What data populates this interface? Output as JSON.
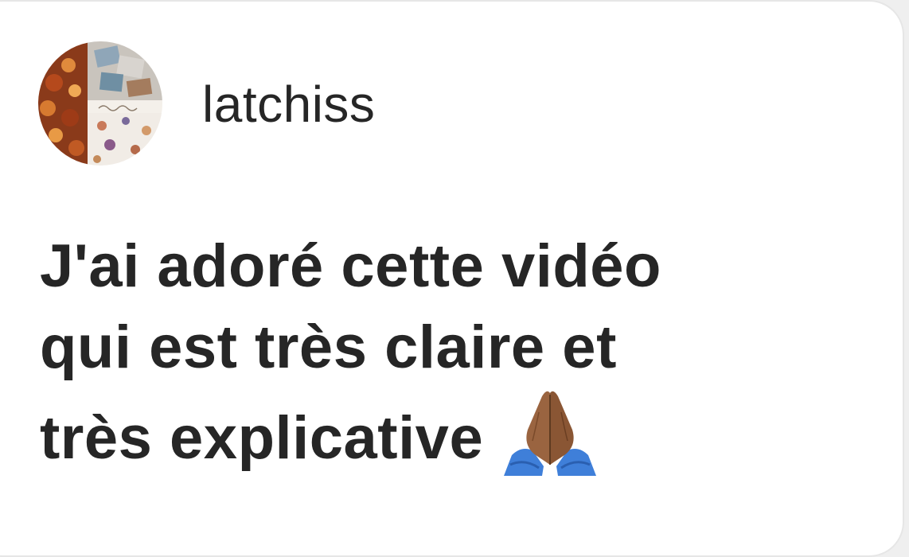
{
  "comment_card": {
    "username": "latchiss",
    "comment_lines": [
      "J'ai adoré cette vidéo",
      "qui est très claire et",
      "très explicative"
    ],
    "emoji": "folded-hands-icon"
  },
  "colors": {
    "text": "#262626",
    "background": "#ffffff",
    "border": "#e6e6e6"
  }
}
